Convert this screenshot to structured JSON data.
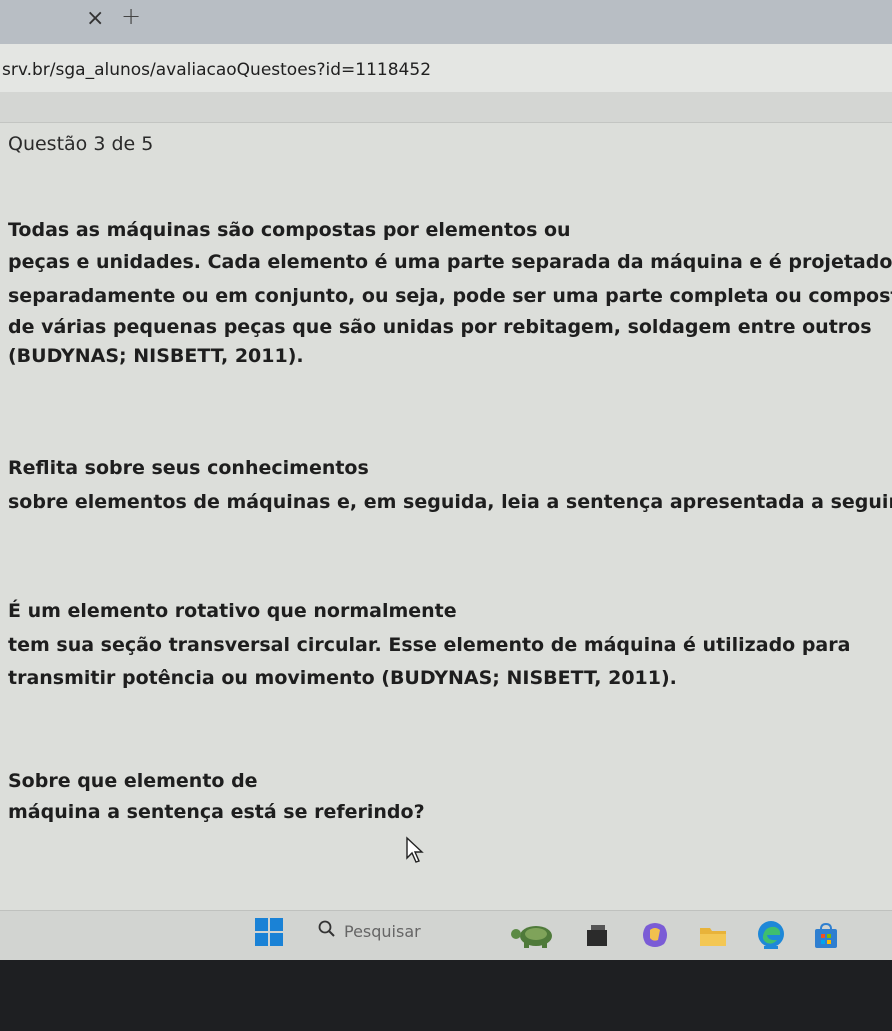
{
  "browser": {
    "close_tab_glyph": "×",
    "new_tab_glyph": "+",
    "url": "srv.br/sga_alunos/avaliacaoQuestoes?id=1118452"
  },
  "question": {
    "title": "Questão 3 de 5",
    "p1": [
      "Todas as máquinas são compostas por elementos ou",
      "peças e unidades. Cada elemento é uma parte separada da máquina e é projetado",
      "separadamente ou em conjunto, ou seja, pode ser uma parte completa ou composta",
      "de várias pequenas peças que são unidas por rebitagem, soldagem entre outros",
      "(BUDYNAS; NISBETT, 2011)."
    ],
    "p2": [
      "Reflita sobre seus conhecimentos",
      "sobre elementos de máquinas e, em seguida, leia a sentença apresentada a seguir:"
    ],
    "p3": [
      "É um elemento rotativo que normalmente",
      "tem sua seção transversal circular. Esse elemento de máquina é utilizado para",
      "transmitir potência ou movimento (BUDYNAS; NISBETT, 2011)."
    ],
    "p4": [
      "Sobre que elemento de",
      "máquina a sentença está se referindo?"
    ]
  },
  "taskbar": {
    "search_label": "Pesquisar",
    "icons": [
      "windows-start-icon",
      "search-icon",
      "turtle-widget-icon",
      "task-view-icon",
      "copilot-icon",
      "file-explorer-icon",
      "edge-browser-icon",
      "store-icon"
    ],
    "colors": {
      "start": "#1a82d6",
      "edge": "#1e88d8",
      "explorer": "#e8b33a",
      "store": "#2f7fd0"
    }
  }
}
